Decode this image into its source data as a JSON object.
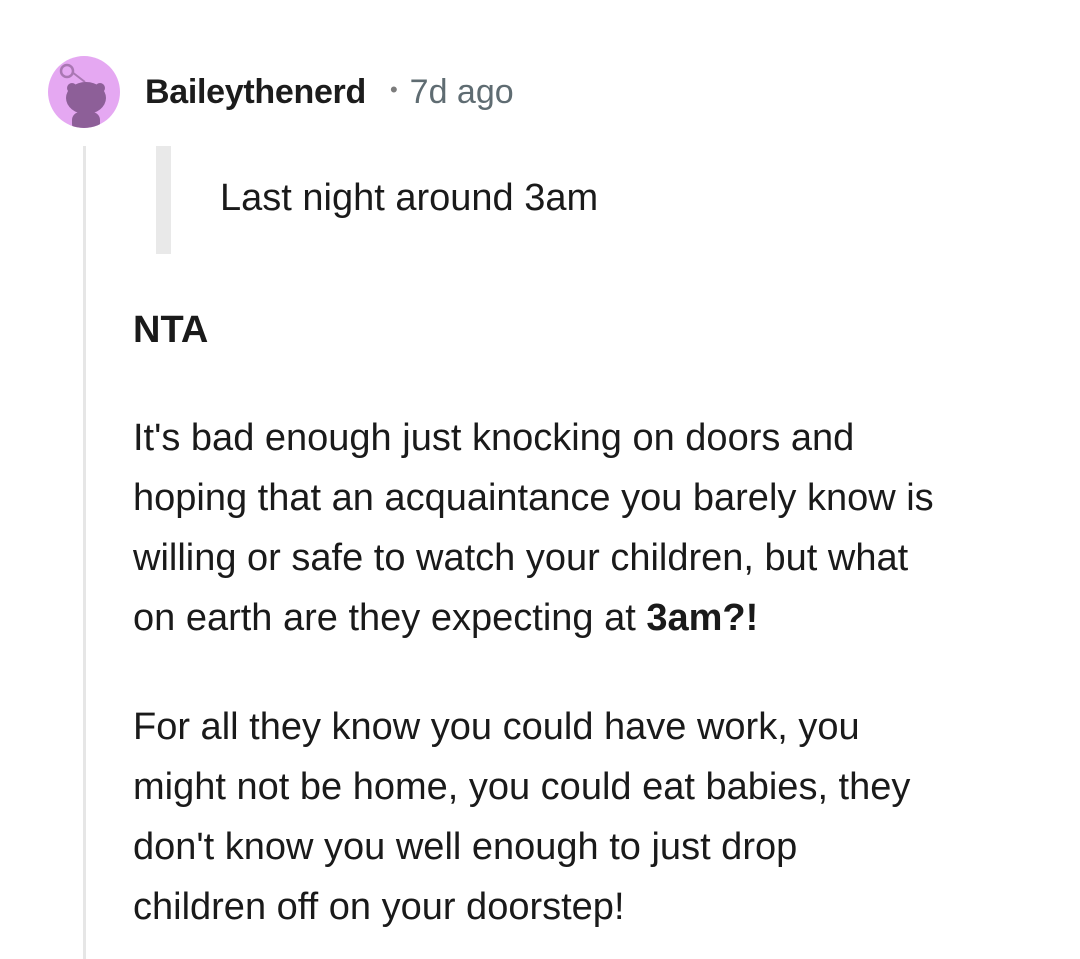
{
  "comment": {
    "author": "Baileythenerd",
    "separator": "•",
    "timestamp": "7d ago",
    "avatar_icon": "reddit-snoo-avatar-icon",
    "avatar_color": "#e5a8f2",
    "quote": "Last night around 3am",
    "verdict": "NTA",
    "paragraph1": {
      "lines": [
        "It's bad enough just knocking on doors and",
        "hoping that an acquaintance you barely know is",
        "willing or safe to watch your children, but what",
        "on earth are they expecting at "
      ],
      "bold_end": "3am?!"
    },
    "paragraph2": {
      "lines": [
        "For all they know you could have work, you",
        "might not be home, you could eat babies, they",
        "don't know you well enough to just drop",
        "children off on your doorstep!"
      ]
    }
  }
}
